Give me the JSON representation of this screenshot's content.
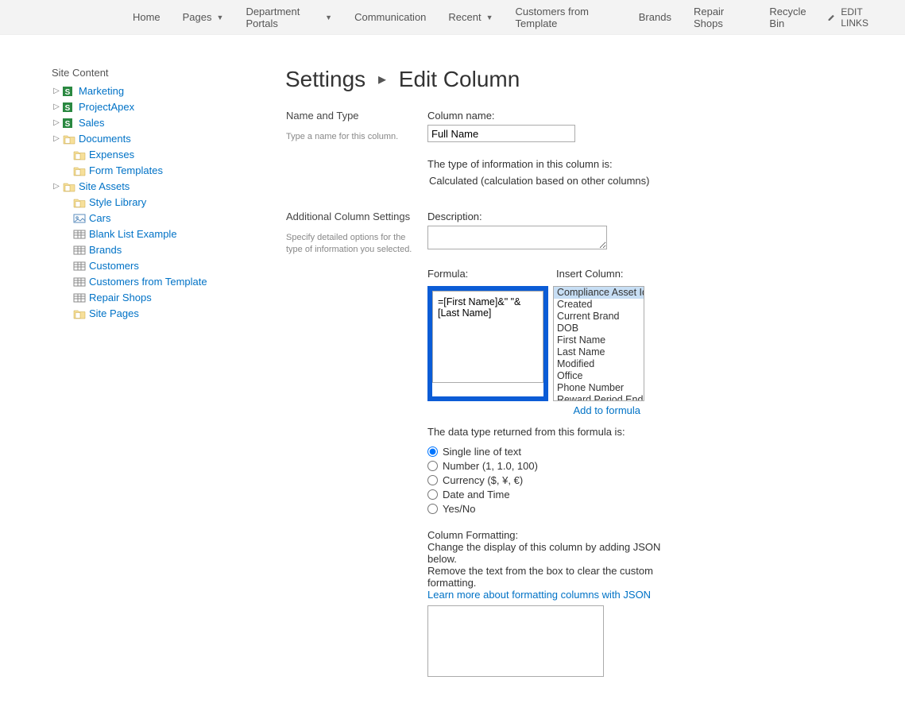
{
  "topnav": {
    "items": [
      {
        "label": "Home",
        "caret": false
      },
      {
        "label": "Pages",
        "caret": true
      },
      {
        "label": "Department Portals",
        "caret": true
      },
      {
        "label": "Communication",
        "caret": false
      },
      {
        "label": "Recent",
        "caret": true
      },
      {
        "label": "Customers from Template",
        "caret": false
      },
      {
        "label": "Brands",
        "caret": false
      },
      {
        "label": "Repair Shops",
        "caret": false
      },
      {
        "label": "Recycle Bin",
        "caret": false
      }
    ],
    "edit_links": "EDIT LINKS"
  },
  "sidebar": {
    "header": "Site Content",
    "items": [
      {
        "label": "Marketing",
        "icon": "sp",
        "indent": 1,
        "expander": true
      },
      {
        "label": "ProjectApex",
        "icon": "sp",
        "indent": 1,
        "expander": true
      },
      {
        "label": "Sales",
        "icon": "sp",
        "indent": 1,
        "expander": true
      },
      {
        "label": "Documents",
        "icon": "folder",
        "indent": 1,
        "expander": true
      },
      {
        "label": "Expenses",
        "icon": "folder",
        "indent": 2,
        "expander": false
      },
      {
        "label": "Form Templates",
        "icon": "folder",
        "indent": 2,
        "expander": false
      },
      {
        "label": "Site Assets",
        "icon": "folder",
        "indent": 1,
        "expander": true
      },
      {
        "label": "Style Library",
        "icon": "folder",
        "indent": 2,
        "expander": false
      },
      {
        "label": "Cars",
        "icon": "pic",
        "indent": 2,
        "expander": false
      },
      {
        "label": "Blank List Example",
        "icon": "list",
        "indent": 2,
        "expander": false
      },
      {
        "label": "Brands",
        "icon": "list",
        "indent": 2,
        "expander": false
      },
      {
        "label": "Customers",
        "icon": "list",
        "indent": 2,
        "expander": false
      },
      {
        "label": "Customers from Template",
        "icon": "list",
        "indent": 2,
        "expander": false
      },
      {
        "label": "Repair Shops",
        "icon": "list",
        "indent": 2,
        "expander": false
      },
      {
        "label": "Site Pages",
        "icon": "folder",
        "indent": 2,
        "expander": false
      }
    ]
  },
  "page_title": {
    "settings": "Settings",
    "edit_column": "Edit Column"
  },
  "section_name": {
    "title": "Name and Type",
    "desc": "Type a name for this column.",
    "column_name_label": "Column name:",
    "column_name_value": "Full Name",
    "type_label": "The type of information in this column is:",
    "type_value": "Calculated (calculation based on other columns)"
  },
  "section_settings": {
    "title": "Additional Column Settings",
    "desc": "Specify detailed options for the type of information you selected.",
    "description_label": "Description:",
    "description_value": "",
    "formula_label": "Formula:",
    "formula_value": "=[First Name]&\" \"&[Last Name]",
    "insert_label": "Insert Column:",
    "insert_options": [
      "Compliance Asset Id",
      "Created",
      "Current Brand",
      "DOB",
      "First Name",
      "Last Name",
      "Modified",
      "Office",
      "Phone Number",
      "Reward Period End"
    ],
    "add_to_formula": "Add to formula",
    "return_label": "The data type returned from this formula is:",
    "return_options": [
      "Single line of text",
      "Number (1, 1.0, 100)",
      "Currency ($, ¥, €)",
      "Date and Time",
      "Yes/No"
    ],
    "return_selected": 0,
    "formatting_title": "Column Formatting:",
    "formatting_desc1": "Change the display of this column by adding JSON below.",
    "formatting_desc2": "Remove the text from the box to clear the custom formatting.",
    "formatting_link": "Learn more about formatting columns with JSON",
    "formatting_value": ""
  }
}
